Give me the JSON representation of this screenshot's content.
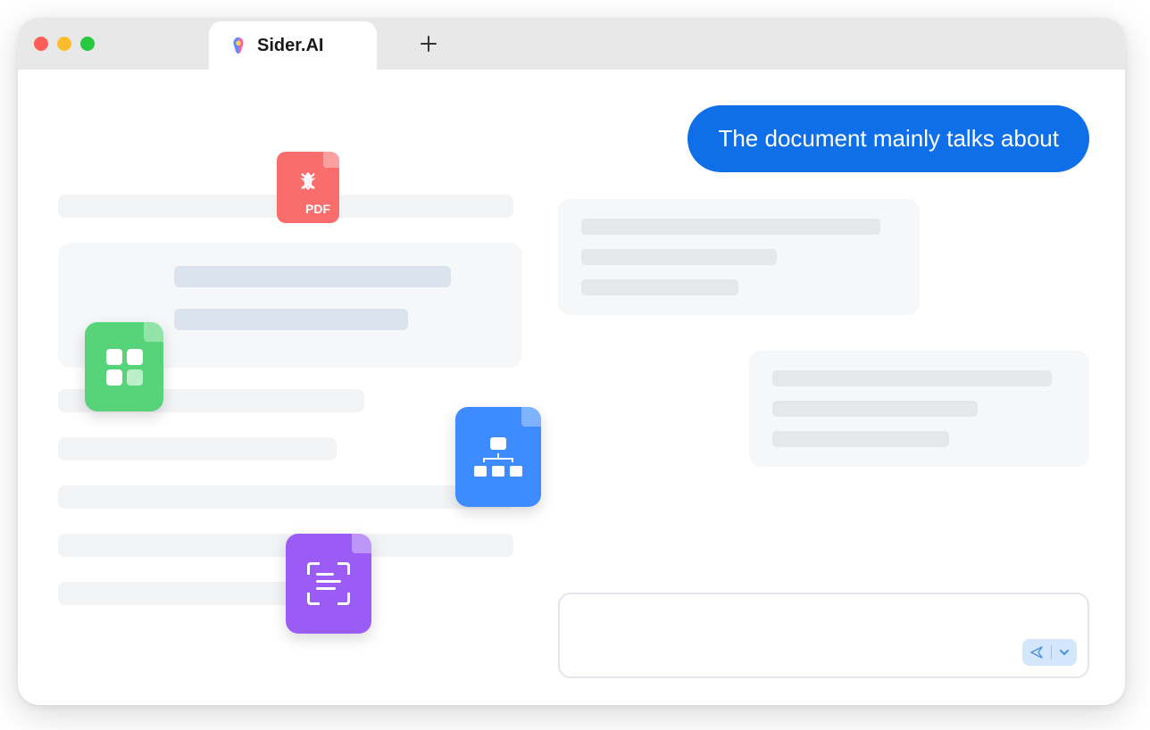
{
  "titlebar": {
    "tab_name": "Sider.AI"
  },
  "chat": {
    "user_message": "The document mainly talks about"
  },
  "file_icons": {
    "pdf_label": "PDF",
    "pdf_name": "pdf-file-icon",
    "sheet_name": "spreadsheet-file-icon",
    "sitemap_name": "sitemap-file-icon",
    "scan_name": "scan-file-icon"
  },
  "chat_input": {
    "placeholder": ""
  },
  "colors": {
    "accent_blue": "#0e6fe8",
    "pdf_red": "#f96d6d",
    "sheet_green": "#57d47a",
    "blue_icon": "#3d8bff",
    "scan_purple": "#9b5cf6"
  }
}
